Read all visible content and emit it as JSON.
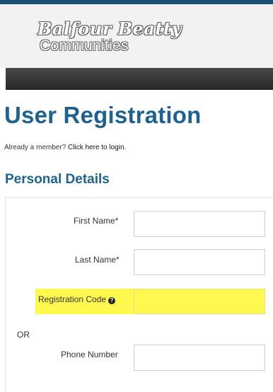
{
  "brand": {
    "line1": "Balfour Beatty",
    "line2": "Communities"
  },
  "page": {
    "title": "User Registration",
    "member_prompt": "Already a member?",
    "login_link": "Click here to login."
  },
  "section": {
    "title": "Personal Details"
  },
  "form": {
    "first_name": {
      "label": "First Name*",
      "value": ""
    },
    "last_name": {
      "label": "Last Name*",
      "value": ""
    },
    "registration_code": {
      "label": "Registration Code",
      "value": "",
      "highlighted": true
    },
    "or_label": "OR",
    "phone_number": {
      "label": "Phone Number",
      "value": ""
    }
  },
  "icons": {
    "help": "question-circle-icon"
  },
  "colors": {
    "heading": "#20628f",
    "highlight": "#fff94f",
    "navbar": "#333333"
  }
}
